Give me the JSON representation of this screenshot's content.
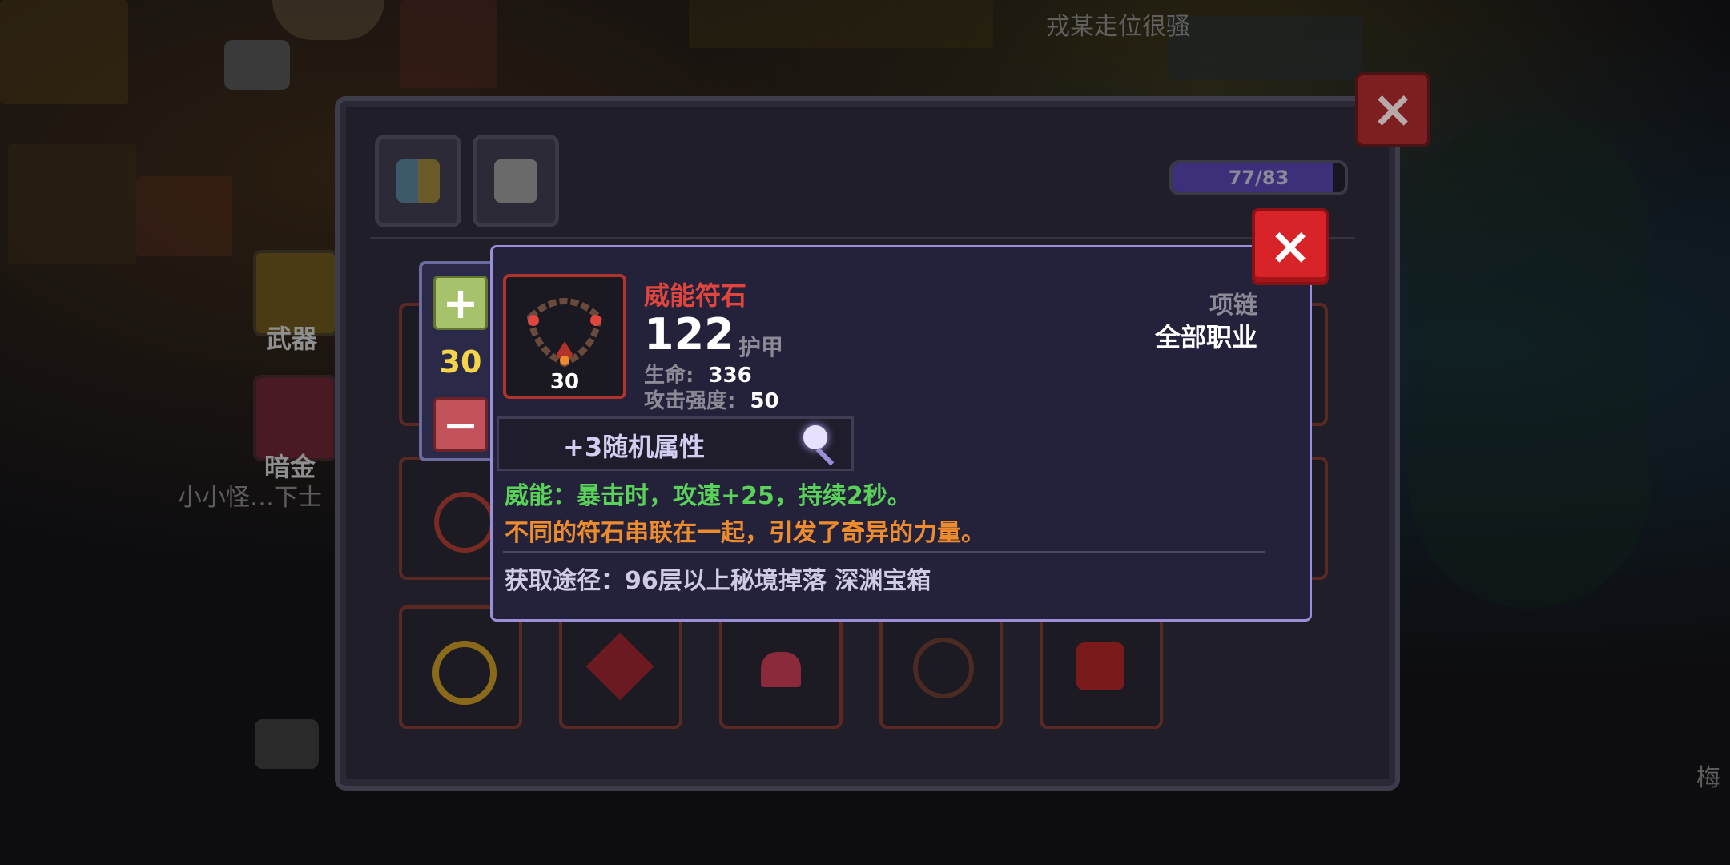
{
  "background": {
    "player_name_top": "戎某走位很骚",
    "player_name_left": "小小怪…下士",
    "player_name_right": "梅",
    "side_labels": {
      "weapon": "武器",
      "dark_gold": "暗金"
    }
  },
  "panel": {
    "close_label": "×",
    "capacity": {
      "text": "77/83",
      "fraction": 0.928
    },
    "tabs": [
      "grid-icon",
      "armor-icon"
    ]
  },
  "quantity": {
    "plus_label": "+",
    "minus_label": "−",
    "value": "30"
  },
  "tooltip": {
    "close_label": "×",
    "item": {
      "name": "威能符石",
      "level": "30",
      "type": "项链",
      "class": "全部职业",
      "armor_value": "122",
      "armor_label": "护甲",
      "stats": [
        {
          "label": "生命:",
          "value": "336"
        },
        {
          "label": "攻击强度:",
          "value": "50"
        }
      ],
      "random_attr": "+3随机属性",
      "effect": "威能：暴击时，攻速+25，持续2秒。",
      "flavor": "不同的符石串联在一起，引发了奇异的力量。",
      "source": "获取途径：96层以上秘境掉落 深渊宝箱"
    }
  },
  "colors": {
    "item_name": "#e0463e",
    "effect": "#5ad25a",
    "flavor": "#ec8c2e",
    "level_value": "#f5d34a",
    "close_red": "#d82329"
  }
}
